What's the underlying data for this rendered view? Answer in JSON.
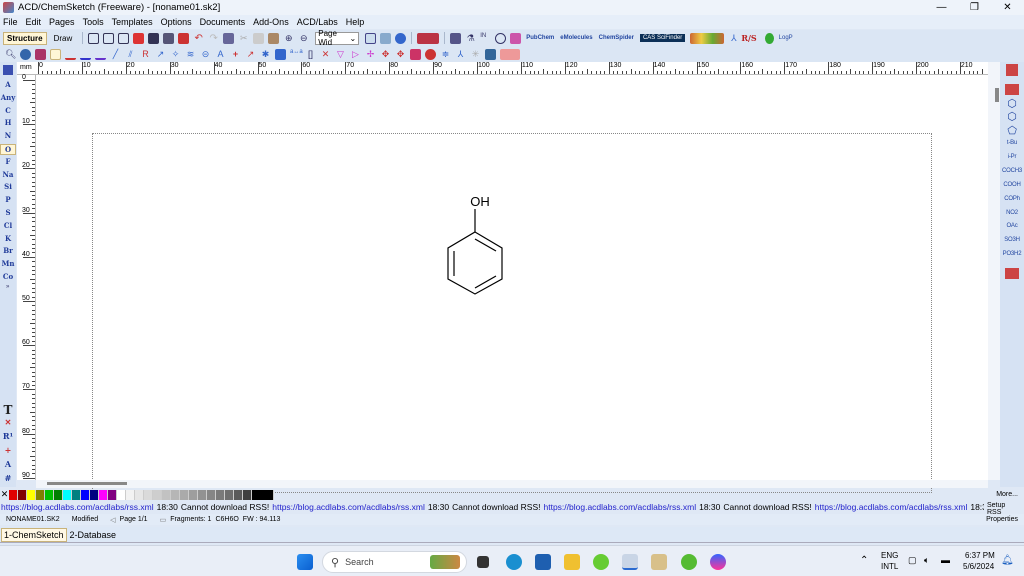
{
  "window": {
    "title": "ACD/ChemSketch (Freeware) - [noname01.sk2]",
    "min": "—",
    "max": "❐",
    "close": "✕"
  },
  "menu": [
    "File",
    "Edit",
    "Pages",
    "Tools",
    "Templates",
    "Options",
    "Documents",
    "Add-Ons",
    "ACD/Labs",
    "Help"
  ],
  "toolbar1": {
    "modes": [
      "Structure",
      "Draw"
    ],
    "zoom_select": "Page Wid",
    "links": [
      "PubChem",
      "eMolecules",
      "ChemSpider"
    ],
    "cas": "CAS SciFinder",
    "rs": "R/S",
    "logp": "LogP"
  },
  "left_palette": {
    "elements": [
      "A",
      "Any",
      "C",
      "H",
      "N",
      "O",
      "F",
      "Na",
      "Si",
      "P",
      "S",
      "Cl",
      "K",
      "Br",
      "Mn",
      "Co"
    ],
    "selected": "O",
    "tools": [
      "T",
      "✕",
      "R¹",
      "+",
      "A",
      "#"
    ]
  },
  "right_palette": {
    "groups": [
      "t-Bu",
      "i-Pr",
      "COCH3",
      "COOH",
      "COPh",
      "NO2",
      "OAc",
      "SO3H",
      "PO3H2"
    ]
  },
  "ruler": {
    "unit": "mm",
    "top_labels": [
      "0",
      "10",
      "20",
      "30",
      "40",
      "50",
      "60",
      "70",
      "80",
      "90",
      "100",
      "110",
      "120",
      "130",
      "140",
      "150",
      "160",
      "170",
      "180",
      "190",
      "200",
      "210"
    ],
    "left_labels": [
      "0",
      "10",
      "20",
      "30",
      "40",
      "50",
      "60",
      "70",
      "80",
      "90"
    ]
  },
  "molecule": {
    "name_label": "OH"
  },
  "colors": [
    "#e00000",
    "#800000",
    "#ffff00",
    "#808000",
    "#00c000",
    "#008000",
    "#00ffff",
    "#008080",
    "#0000ff",
    "#000080",
    "#ff00ff",
    "#800080",
    "#ffffff",
    "#f2f2f2",
    "#e6e6e6",
    "#dadada",
    "#cecece",
    "#c2c2c2",
    "#b6b6b6",
    "#aaaaaa",
    "#9e9e9e",
    "#929292",
    "#868686",
    "#7a7a7a",
    "#6e6e6e",
    "#5a5a5a",
    "#404040",
    "#000000"
  ],
  "more_label": "More...",
  "rss": {
    "url": "https://blog.acdlabs.com/acdlabs/rss.xml",
    "time": "18:30",
    "message": "Cannot download RSS!",
    "setup": "Setup RSS"
  },
  "status": {
    "file": "NONAME01.SK2",
    "state": "Modified",
    "page": "Page 1/1",
    "fragments": "Fragments: 1",
    "formula": "C6H6O",
    "fw": "FW : 94.113",
    "properties": "Properties"
  },
  "tabs": [
    "1-ChemSketch",
    "2-Database"
  ],
  "taskbar": {
    "search": "Search",
    "lang1": "ENG",
    "lang2": "INTL",
    "time": "6:37 PM",
    "date": "5/6/2024"
  }
}
